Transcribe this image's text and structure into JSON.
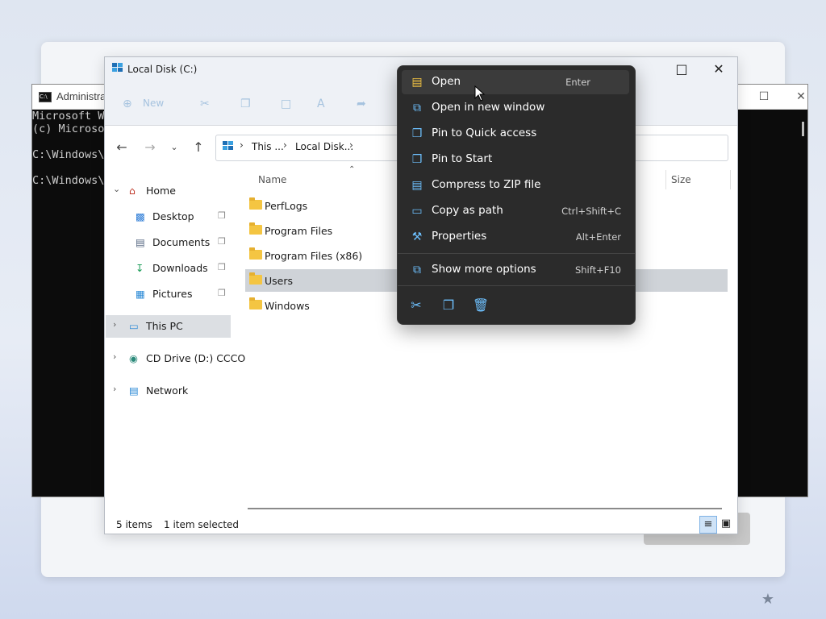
{
  "cmd": {
    "title": "Administrat",
    "lines": [
      "Microsoft Wi",
      "(c) Microso",
      "",
      "C:\\Windows\\S",
      "",
      "C:\\Windows\\S"
    ]
  },
  "explorer": {
    "title": "Local Disk (C:)",
    "toolbar": {
      "new_label": "New"
    },
    "breadcrumb": [
      "This ...",
      "Local Disk..."
    ],
    "sidebar": [
      {
        "label": "Home",
        "expandable": true,
        "expanded": true
      },
      {
        "label": "Desktop",
        "pinned": true
      },
      {
        "label": "Documents",
        "pinned": true
      },
      {
        "label": "Downloads",
        "pinned": true
      },
      {
        "label": "Pictures",
        "pinned": true
      },
      {
        "label": "This PC",
        "expandable": true,
        "selected": true
      },
      {
        "label": "CD Drive (D:) CCCO",
        "expandable": true
      },
      {
        "label": "Network",
        "expandable": true
      }
    ],
    "columns": {
      "name": "Name",
      "size": "Size"
    },
    "files": [
      {
        "name": "PerfLogs"
      },
      {
        "name": "Program Files"
      },
      {
        "name": "Program Files (x86)"
      },
      {
        "name": "Users",
        "selected": true
      },
      {
        "name": "Windows"
      }
    ],
    "status": {
      "count": "5 items",
      "selection": "1 item selected"
    }
  },
  "context_menu": {
    "items": [
      {
        "label": "Open",
        "shortcut": "Enter",
        "icon": "folder-open-icon"
      },
      {
        "label": "Open in new window",
        "shortcut": "",
        "icon": "open-new-window-icon"
      },
      {
        "label": "Pin to Quick access",
        "shortcut": "",
        "icon": "pin-icon"
      },
      {
        "label": "Pin to Start",
        "shortcut": "",
        "icon": "pin-icon"
      },
      {
        "label": "Compress to ZIP file",
        "shortcut": "",
        "icon": "zip-icon"
      },
      {
        "label": "Copy as path",
        "shortcut": "Ctrl+Shift+C",
        "icon": "copy-path-icon"
      },
      {
        "label": "Properties",
        "shortcut": "Alt+Enter",
        "icon": "wrench-icon"
      },
      {
        "label": "Show more options",
        "shortcut": "Shift+F10",
        "icon": "more-options-icon"
      }
    ]
  },
  "colors": {
    "menu_bg": "#2b2b2b",
    "accent": "#6ec1ff",
    "folder": "#f4c542",
    "selection": "#cfd3d8"
  }
}
